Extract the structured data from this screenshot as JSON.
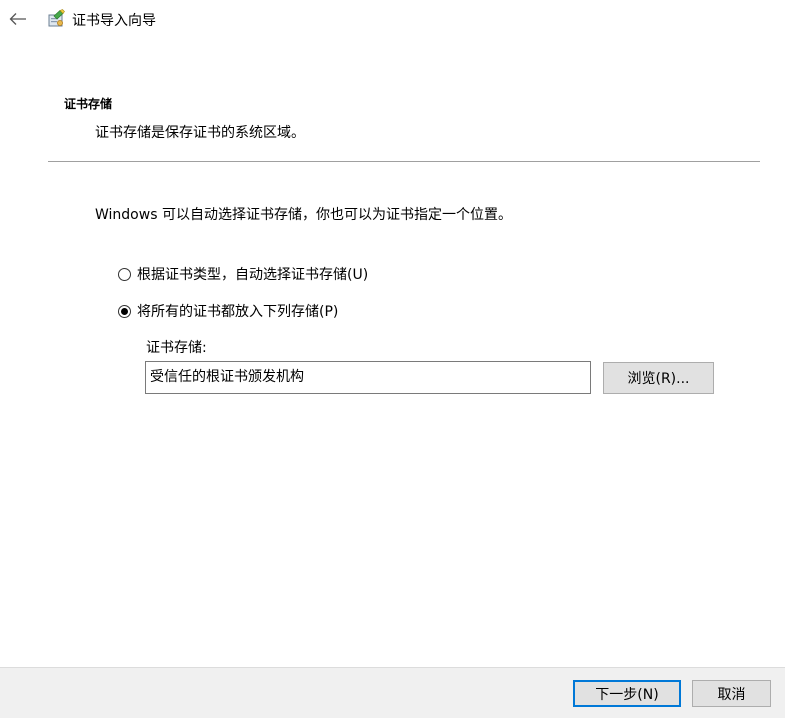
{
  "window": {
    "title": "证书导入向导",
    "back_icon": "arrow-left-icon",
    "app_icon": "certificate-wizard-icon"
  },
  "header": {
    "title": "证书存储",
    "subtitle": "证书存储是保存证书的系统区域。"
  },
  "main": {
    "intro": "Windows 可以自动选择证书存储，你也可以为证书指定一个位置。",
    "options": [
      {
        "label": "根据证书类型，自动选择证书存储(U)",
        "selected": false
      },
      {
        "label": "将所有的证书都放入下列存储(P)",
        "selected": true
      }
    ],
    "store_label": "证书存储:",
    "store_value": "受信任的根证书颁发机构",
    "browse_label": "浏览(R)..."
  },
  "footer": {
    "next_label": "下一步(N)",
    "cancel_label": "取消"
  },
  "colors": {
    "accent": "#0078d7",
    "footer_bg": "#f0f0f0",
    "button_bg": "#e1e1e1"
  }
}
